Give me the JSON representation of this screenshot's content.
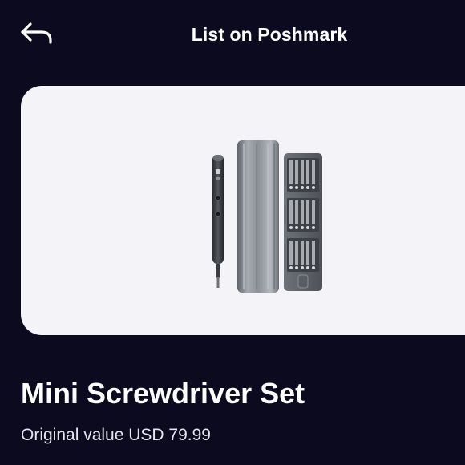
{
  "header": {
    "title": "List on Poshmark",
    "back_icon": "back-arrow-icon"
  },
  "product": {
    "image_icon": "screwdriver-set-image",
    "title": "Mini Screwdriver Set",
    "original_value": "Original value USD 79.99"
  },
  "colors": {
    "background": "#0c0a1f",
    "card": "#f4f4f8",
    "text": "#ffffff"
  }
}
